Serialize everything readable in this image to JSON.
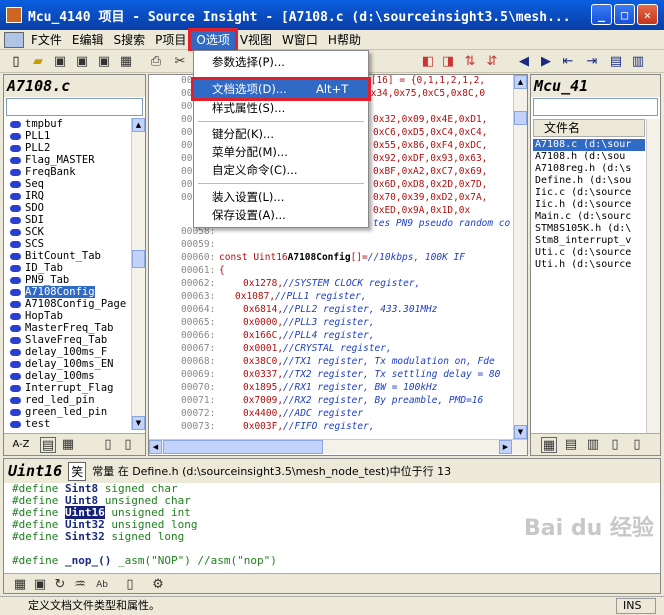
{
  "window": {
    "title": "Mcu_4140 项目 - Source Insight - [A7108.c (d:\\sourceinsight3.5\\mesh...",
    "minimize": "_",
    "maximize": "□",
    "close": "✕"
  },
  "menubar": {
    "items": [
      {
        "label": "F文件"
      },
      {
        "label": "E编辑"
      },
      {
        "label": "S搜索"
      },
      {
        "label": "P项目"
      },
      {
        "label": "O选项"
      },
      {
        "label": "V视图"
      },
      {
        "label": "W窗口"
      },
      {
        "label": "H帮助"
      }
    ],
    "active_index": 4
  },
  "options_menu": {
    "items": [
      {
        "label": "参数选择(P)...",
        "shortcut": ""
      },
      {
        "label": "文档选项(D)...",
        "shortcut": "Alt+T"
      },
      {
        "label": "样式属性(S)...",
        "shortcut": ""
      },
      {
        "label": "键分配(K)...",
        "shortcut": ""
      },
      {
        "label": "菜单分配(M)...",
        "shortcut": ""
      },
      {
        "label": "自定义命令(C)...",
        "shortcut": ""
      },
      {
        "label": "装入设置(L)...",
        "shortcut": ""
      },
      {
        "label": "保存设置(A)...",
        "shortcut": ""
      }
    ],
    "highlighted_index": 1
  },
  "left_panel": {
    "title": "A7108.c",
    "symbols": [
      "tmpbuf",
      "PLL1",
      "PLL2",
      "Flag_MASTER",
      "FreqBank",
      "Seq",
      "IRQ",
      "SDO",
      "SDI",
      "SCK",
      "SCS",
      "BitCount_Tab",
      "ID_Tab",
      "PN9_Tab",
      "A7108Config",
      "A7108Config_Page",
      "HopTab",
      "MasterFreq_Tab",
      "SlaveFreq_Tab",
      "delay_100ms_F",
      "delay_100ms_EN",
      "delay_100ms",
      "Interrupt_Flag",
      "red_led_pin",
      "green_led_pin",
      "test"
    ],
    "selected_index": 14,
    "tab_label": "A-Z"
  },
  "editor": {
    "top_line_1": "b[16] = {0,1,1,2,1,2,",
    "top_line_2": "0x34,0x75,0xC5,0x8C,0",
    "right_frag": [
      "0x32,0x09,0x4E,0xD1,",
      "0xC6,0xD5,0xC4,0xC4,",
      "0x55,0x86,0xF4,0xDC,",
      "0x92,0xDF,0x93,0x63,",
      "0xBF,0xA2,0xC7,0x69,",
      "0x6D,0xD8,0x2D,0x7D,",
      "0x70,0x39,0xD2,0x7A,",
      "0xED,0x9A,0x1D,0x",
      "tes PN9 pseudo random co"
    ],
    "left_line_nums": [
      "0005",
      "00",
      "00",
      "00",
      "00",
      "00",
      "00",
      "00",
      "00",
      "00"
    ],
    "lines": [
      {
        "num": "00058:",
        "code": ""
      },
      {
        "num": "00059:",
        "code": ""
      },
      {
        "num": "00060:",
        "kw": "const Uint16 ",
        "fn": "A7108Config",
        "rest": "[]=",
        "cm": " //10kbps, 100K IF"
      },
      {
        "num": "00061:",
        "code": "{"
      },
      {
        "num": "00062:",
        "val": "0x1278,",
        "cm": "  //SYSTEM CLOCK register,"
      },
      {
        "num": "00063:",
        "val": "0x1087,",
        "cm": "  //PLL1 register,"
      },
      {
        "num": "00064:",
        "val": "0x6814,",
        "cm": "  //PLL2 register,    433.301MHz"
      },
      {
        "num": "00065:",
        "val": "0x0000,",
        "cm": "  //PLL3 register,"
      },
      {
        "num": "00066:",
        "val": "0x166C,",
        "cm": "  //PLL4 register,"
      },
      {
        "num": "00067:",
        "val": "0x0001,",
        "cm": "  //CRYSTAL register,"
      },
      {
        "num": "00068:",
        "val": "0x38C0,",
        "cm": "  //TX1 register, Tx modulation on, Fde"
      },
      {
        "num": "00069:",
        "val": "0x0337,",
        "cm": "  //TX2 register, Tx settling delay = 80"
      },
      {
        "num": "00070:",
        "val": "0x1895,",
        "cm": "  //RX1 register,    BW = 100kHz"
      },
      {
        "num": "00071:",
        "val": "0x7009,",
        "cm": "  //RX2 register, By preamble, PMD=16"
      },
      {
        "num": "00072:",
        "val": "0x4400,",
        "cm": "  //ADC register"
      },
      {
        "num": "00073:",
        "val": "0x003F,",
        "cm": "  //FIFO register,"
      }
    ]
  },
  "right_panel": {
    "title": "Mcu_41",
    "col_header": "文件名",
    "files": [
      "A7108.c (d:\\sour",
      "A7108.h (d:\\sou",
      "A7108reg.h (d:\\s",
      "Define.h (d:\\sou",
      "Iic.c (d:\\source",
      "Iic.h (d:\\source",
      "Main.c (d:\\sourc",
      "STM8S105K.h (d:\\",
      "Stm8_interrupt_v",
      "Uti.c (d:\\source",
      "Uti.h (d:\\source"
    ],
    "selected_index": 0
  },
  "context": {
    "symbol": "Uint16",
    "icon": "笑",
    "description": "常量 在 Define.h (d:\\sourceinsight3.5\\mesh_node_test)中位于行 13",
    "lines": [
      {
        "d": "#define ",
        "n": "Sint8",
        "t": "  signed   char"
      },
      {
        "d": "#define ",
        "n": "Uint8",
        "t": "  unsigned char"
      },
      {
        "d": "#define ",
        "n": "Uint16",
        "t": " unsigned int",
        "hl": true
      },
      {
        "d": "#define ",
        "n": "Uint32",
        "t": " unsigned long"
      },
      {
        "d": "#define ",
        "n": "Sint32",
        "t": " signed long"
      },
      {
        "d": "",
        "n": "",
        "t": ""
      },
      {
        "d": "#define ",
        "n": "_nop_()",
        "t": " _asm(\"NOP\") //asm(\"nop\")"
      }
    ]
  },
  "statusbar": {
    "text": "定义文档文件类型和属性。",
    "ins": "INS"
  },
  "watermark": "Bai du 经验"
}
